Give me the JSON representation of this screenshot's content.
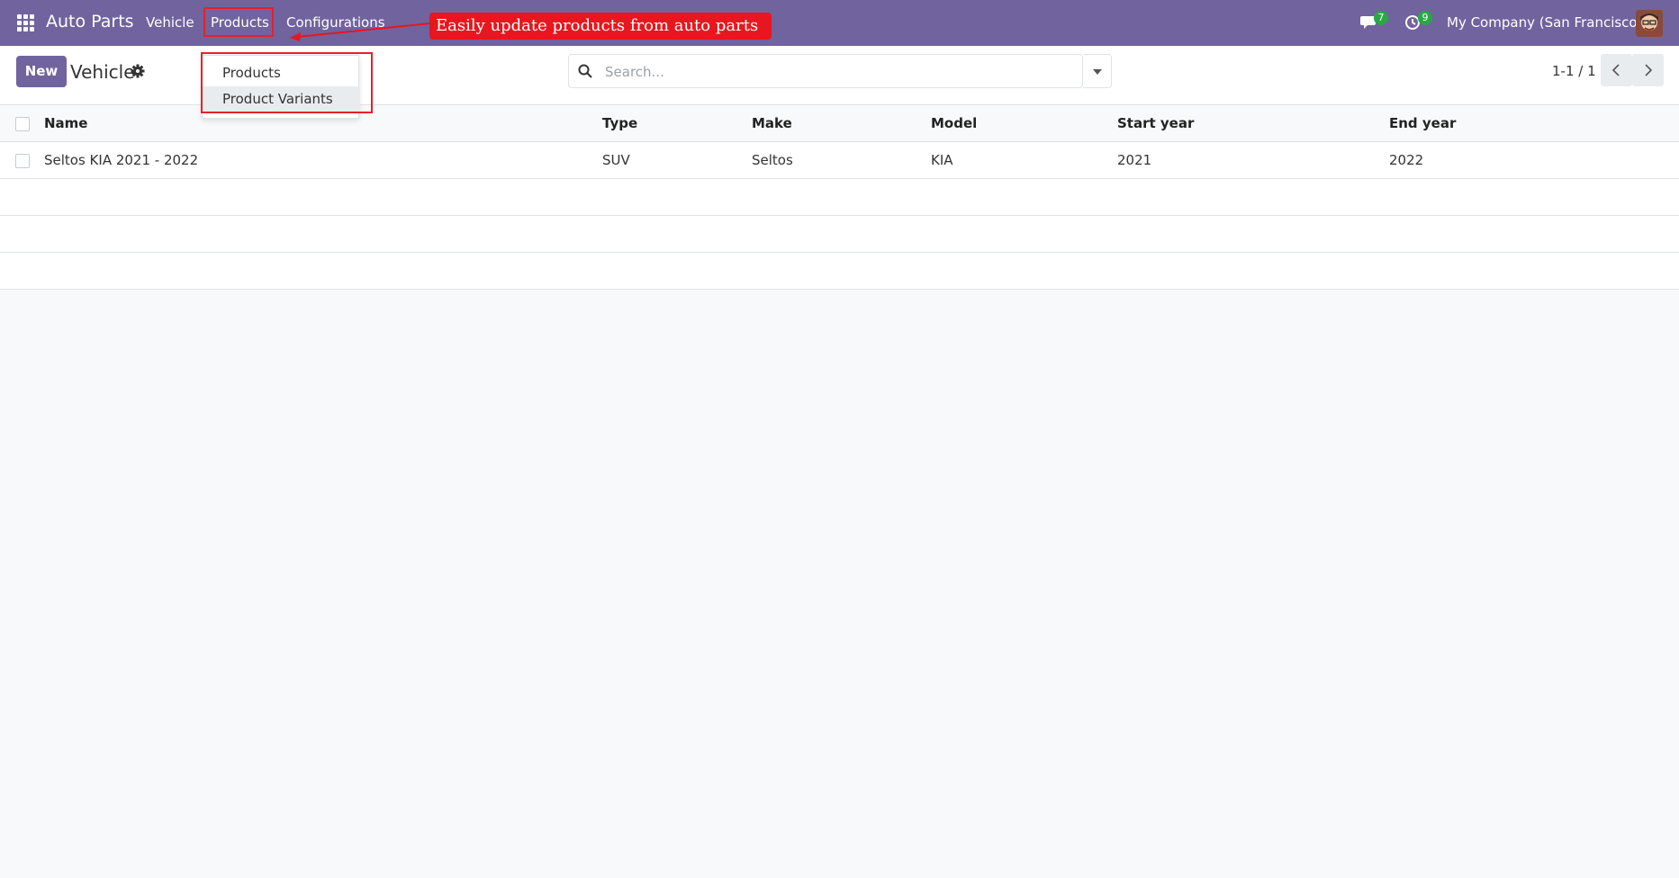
{
  "navbar": {
    "brand": "Auto Parts",
    "menu": {
      "vehicle": "Vehicle",
      "products": "Products",
      "configurations": "Configurations"
    },
    "annotation": "Easily update products from auto parts",
    "messages_count": "7",
    "activities_count": "9",
    "company": "My Company (San Francisco)",
    "color": "#71639e"
  },
  "products_dropdown": {
    "items": [
      "Products",
      "Product Variants"
    ]
  },
  "control_panel": {
    "new_label": "New",
    "breadcrumb": "Vehicle",
    "search_placeholder": "Search...",
    "pager": "1-1 / 1"
  },
  "table": {
    "columns": [
      "Name",
      "Type",
      "Make",
      "Model",
      "Start year",
      "End year"
    ],
    "rows": [
      {
        "name": "Seltos KIA 2021 - 2022",
        "type": "SUV",
        "make": "Seltos",
        "model": "KIA",
        "start_year": "2021",
        "end_year": "2022"
      }
    ]
  }
}
